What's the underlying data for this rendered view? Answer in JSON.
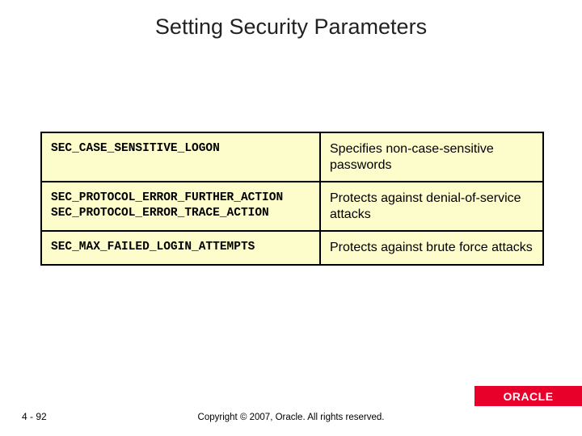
{
  "title": "Setting Security Parameters",
  "table": {
    "rows": [
      {
        "param": "SEC_CASE_SENSITIVE_LOGON",
        "desc": "Specifies non-case-sensitive passwords"
      },
      {
        "param": "SEC_PROTOCOL_ERROR_FURTHER_ACTION\nSEC_PROTOCOL_ERROR_TRACE_ACTION",
        "desc": "Protects against denial-of-service attacks"
      },
      {
        "param": "SEC_MAX_FAILED_LOGIN_ATTEMPTS",
        "desc": "Protects against brute force attacks"
      }
    ]
  },
  "footer": {
    "page": "4 - 92",
    "copyright": "Copyright © 2007, Oracle. All rights reserved.",
    "logo": "ORACLE"
  }
}
